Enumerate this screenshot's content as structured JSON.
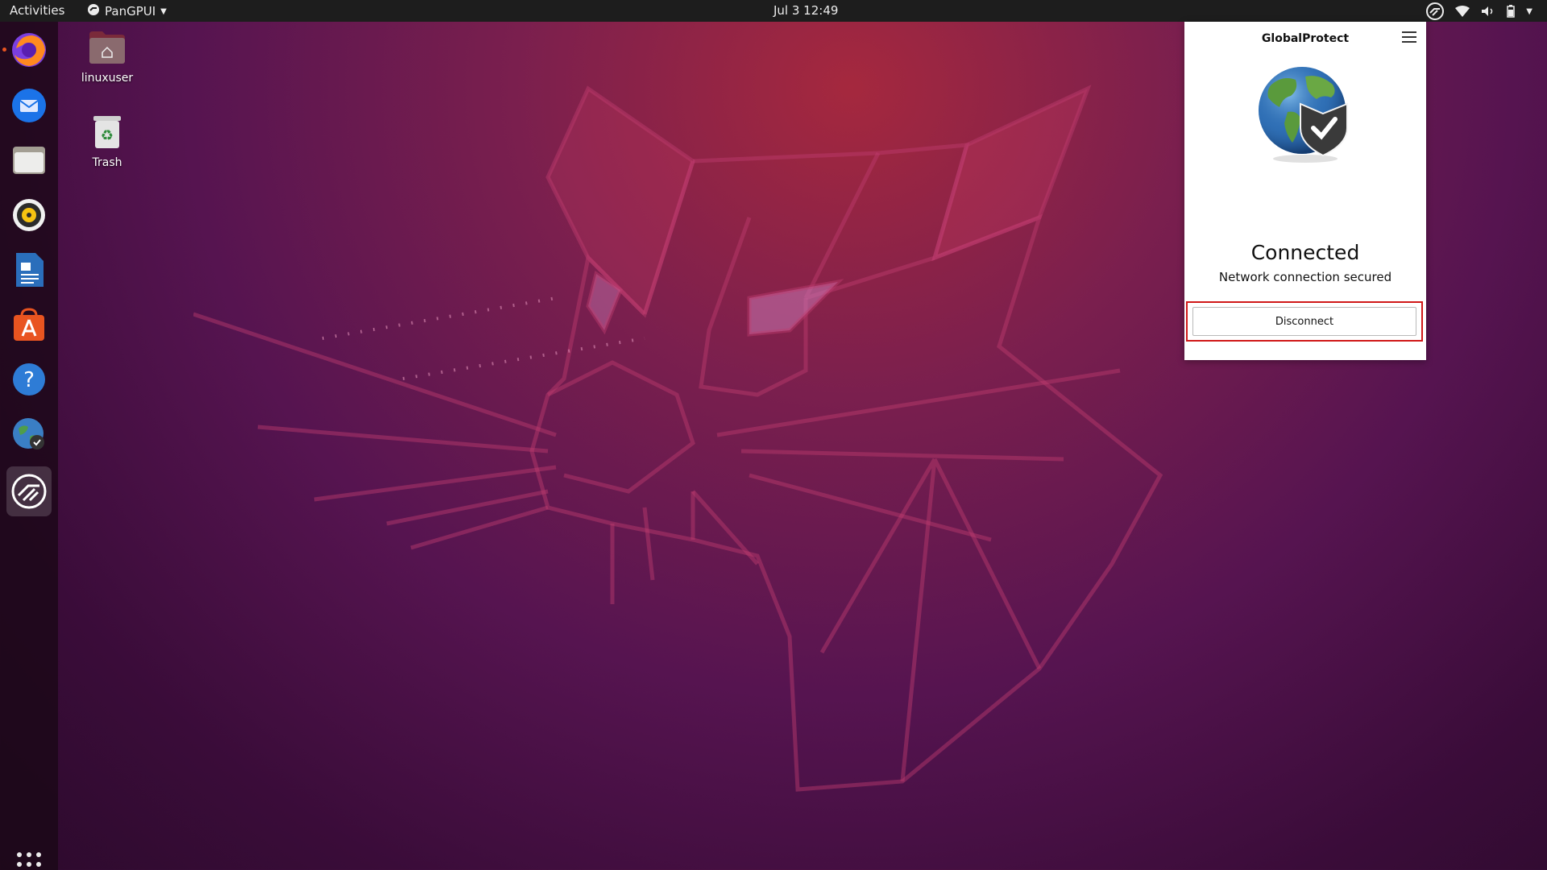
{
  "topbar": {
    "activities": "Activities",
    "app_name": "PanGPUI",
    "clock": "Jul 3  12:49"
  },
  "desktop": {
    "icons": [
      {
        "label": "linuxuser",
        "icon": "home-folder-icon"
      },
      {
        "label": "Trash",
        "icon": "trash-icon"
      }
    ]
  },
  "dock": {
    "items": [
      {
        "name": "firefox",
        "icon": "firefox-icon",
        "running": true
      },
      {
        "name": "thunderbird",
        "icon": "thunderbird-icon"
      },
      {
        "name": "files",
        "icon": "files-icon"
      },
      {
        "name": "rhythmbox",
        "icon": "rhythmbox-icon"
      },
      {
        "name": "libreoffice-writer",
        "icon": "writer-icon"
      },
      {
        "name": "software",
        "icon": "software-icon"
      },
      {
        "name": "help",
        "icon": "help-icon"
      },
      {
        "name": "globalprotect",
        "icon": "globalprotect-icon"
      },
      {
        "name": "pangpui",
        "icon": "pangpui-icon",
        "active": true
      }
    ]
  },
  "globalprotect": {
    "title": "GlobalProtect",
    "status": "Connected",
    "substatus": "Network connection secured",
    "button_label": "Disconnect"
  },
  "colors": {
    "accent_red": "#d01818",
    "ubuntu_orange": "#e95420",
    "topbar": "#1d1d1d"
  }
}
